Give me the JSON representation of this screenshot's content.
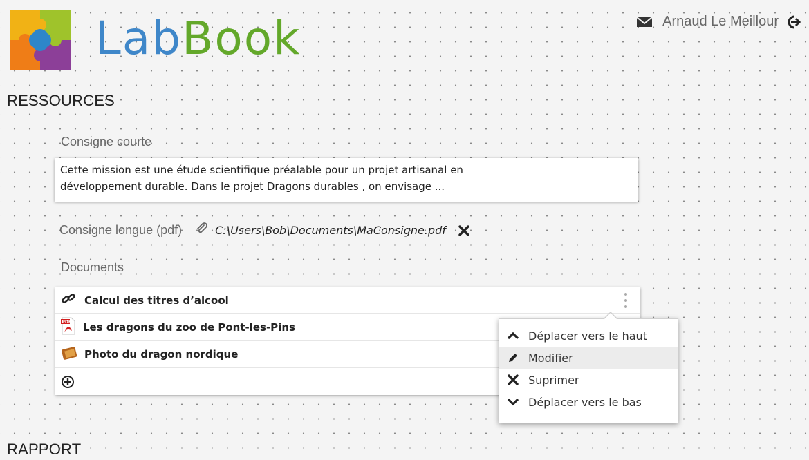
{
  "app": {
    "logo_part1": "Lab",
    "logo_part2": "Book",
    "user_name": "Arnaud Le Meillour"
  },
  "resources": {
    "title": "RESSOURCES",
    "short_label": "Consigne courte",
    "short_text_line1": "Cette mission est une étude scientifique préalable pour un projet artisanal en",
    "short_text_line2": "développement durable. Dans le projet Dragons durables , on envisage ...",
    "long_label": "Consigne longue (pdf)",
    "long_path": "C:\\Users\\Bob\\Documents\\MaConsigne.pdf",
    "documents_label": "Documents",
    "documents": [
      {
        "name": "Calcul des titres d’alcool",
        "icon": "link-icon"
      },
      {
        "name": "Les dragons du zoo de Pont-les-Pins",
        "icon": "pdf-icon"
      },
      {
        "name": "Photo du dragon nordique",
        "icon": "image-icon"
      }
    ]
  },
  "context_menu": {
    "items": [
      {
        "label": "Déplacer vers le haut",
        "icon": "chevron-up-icon"
      },
      {
        "label": "Modifier",
        "icon": "pencil-icon"
      },
      {
        "label": "Suprimer",
        "icon": "close-icon"
      },
      {
        "label": "Déplacer vers le bas",
        "icon": "chevron-down-icon"
      }
    ]
  },
  "report": {
    "title": "RAPPORT"
  },
  "colors": {
    "logo_blue": "#3f87c9",
    "logo_green": "#63a82a"
  }
}
